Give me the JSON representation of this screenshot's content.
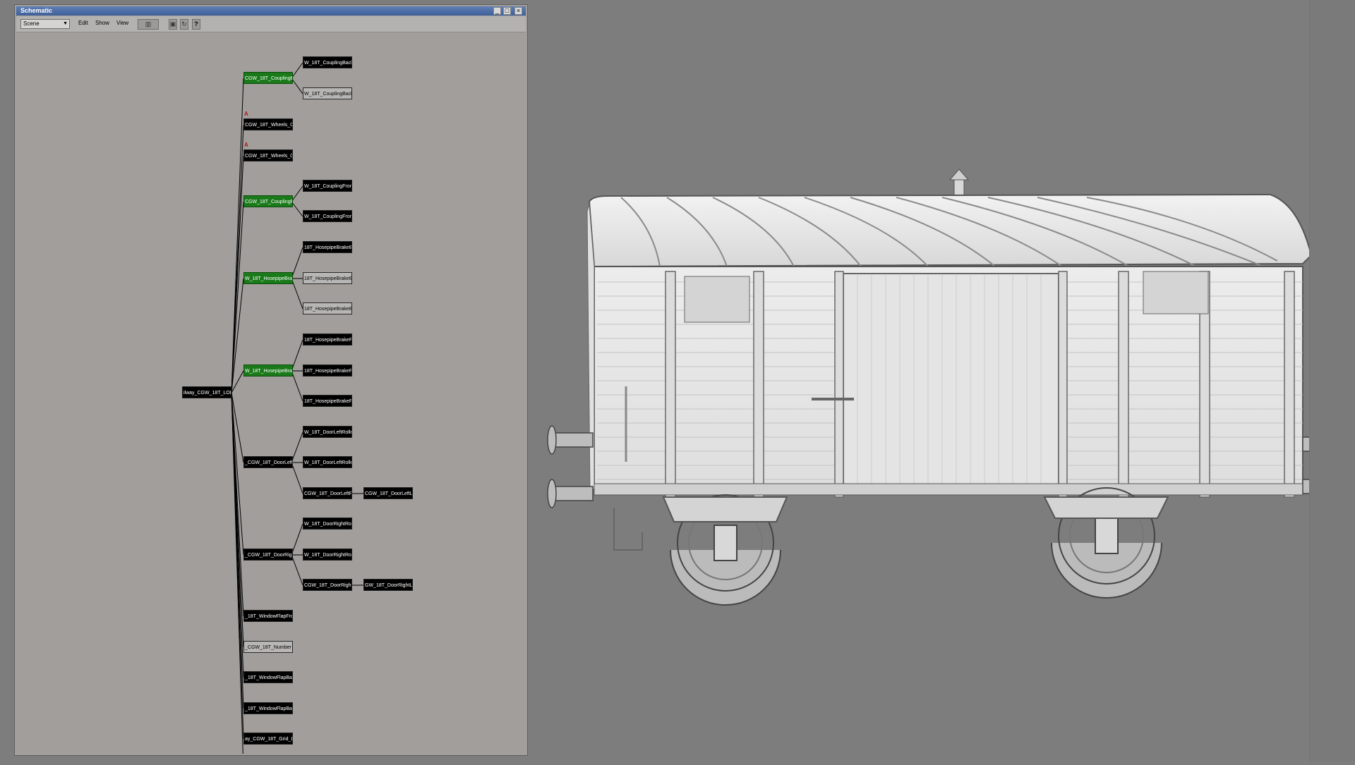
{
  "window": {
    "title": "Schematic",
    "minimize": "_",
    "restore": "□",
    "close": "×"
  },
  "toolbar": {
    "scene_select": "Scene",
    "menu_edit": "Edit",
    "menu_show": "Show",
    "menu_view": "View",
    "help": "?"
  },
  "nodes": {
    "root": "ilway_CGW_18T_LOD",
    "coupling_back": "CGW_18T_CouplingBa",
    "coupling_back_1": "W_18T_CouplingBack",
    "coupling_back_2": "W_18T_CouplingBack",
    "wheels_1": "CGW_18T_Wheels_0",
    "wheels_2": "CGW_18T_Wheels_0",
    "coupling_front": "CGW_18T_CouplingFr",
    "coupling_front_1": "W_18T_CouplingFront",
    "coupling_front_2": "W_18T_CouplingFront",
    "hosepipe_back": "W_18T_HosepipeBrake",
    "hosepipe_back_1": "18T_HosepipeBrakeBa",
    "hosepipe_back_2": "18T_HosepipeBrakeBa",
    "hosepipe_back_3": "18T_HosepipeBrakeBa",
    "hosepipe_front": "W_18T_HosepipeBrake",
    "hosepipe_front_1": "18T_HosepipeBrakeFr",
    "hosepipe_front_2": "18T_HosepipeBrakeFr",
    "hosepipe_front_3": "18T_HosepipeBrakeFr",
    "door_left": "_CGW_18T_DoorLeft",
    "door_left_1": "W_18T_DoorLeftRolle",
    "door_left_2": "W_18T_DoorLeftRolle",
    "door_left_3": "CGW_18T_DoorLeftP",
    "door_left_3a": "CGW_18T_DoorLeftLo",
    "door_right": "_CGW_18T_DoorRigh",
    "door_right_1": "W_18T_DoorRightRolle",
    "door_right_2": "W_18T_DoorRightRoll",
    "door_right_3": "CGW_18T_DoorRightP",
    "door_right_3a": "GW_18T_DoorRightLo",
    "window_flap_front_1": "_18T_WindowFlapFro",
    "number": "_CGW_18T_Number",
    "window_flap_back_1": "_18T_WindowFlapBa",
    "window_flap_back_2": "_18T_WindowFlapBac",
    "grid": "ay_CGW_18T_Grid_L",
    "window_flap_front_2": "_18T_WindowFlapFro"
  },
  "anim_markers": {
    "wheels_1": "A",
    "wheels_2": "A"
  }
}
